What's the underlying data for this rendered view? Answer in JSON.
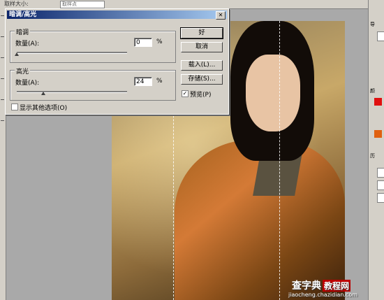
{
  "app": {
    "toolbar_label": "取样大小:",
    "toolbar_value": "取样点"
  },
  "dialog": {
    "title": "暗调/高光",
    "close_glyph": "✕",
    "shadows": {
      "legend": "暗调",
      "amount_label": "数量(A):",
      "amount_value": "0",
      "unit": "%",
      "slider_level_percent": 0
    },
    "highlights": {
      "legend": "高光",
      "amount_label": "数量(A):",
      "amount_value": "24",
      "unit": "%",
      "slider_level_percent": 24
    },
    "show_more_label": "显示其他选项(O)",
    "show_more_checked": false,
    "buttons": {
      "ok": "好",
      "cancel": "取消",
      "load": "载入(L)...",
      "save": "存储(S)..."
    },
    "preview_label": "预览(P)",
    "preview_checked": true
  },
  "right_palette": {
    "tabs": [
      "导",
      "颜",
      "历"
    ],
    "swatch_colors": [
      "#e01010",
      "#e06010"
    ]
  },
  "watermark": {
    "main": "查字典",
    "badge": "教程网",
    "url": "jiaocheng.chazidian.com"
  },
  "colors": {
    "dialog_face": "#d4d0c8",
    "title_start": "#0a246a",
    "title_end": "#a6caf0"
  }
}
